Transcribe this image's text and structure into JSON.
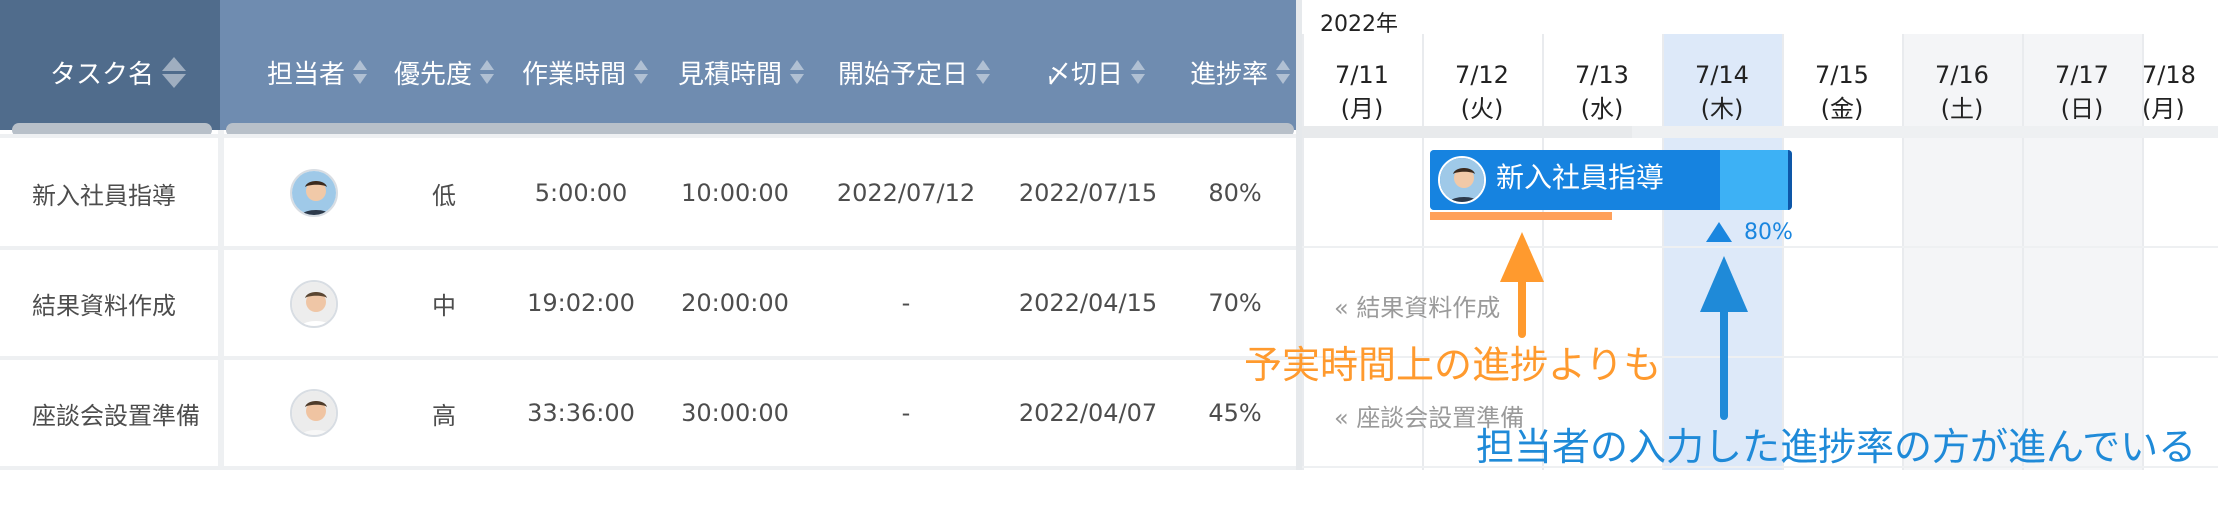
{
  "columns": {
    "name": "タスク名",
    "assignee": "担当者",
    "priority": "優先度",
    "work_time": "作業時間",
    "estimate": "見積時間",
    "start_date": "開始予定日",
    "due_date": "〆切日",
    "progress": "進捗率"
  },
  "rows": [
    {
      "name": "新入社員指導",
      "priority": "低",
      "work_time": "5:00:00",
      "estimate": "10:00:00",
      "start_date": "2022/07/12",
      "due_date": "2022/07/15",
      "progress": "80%"
    },
    {
      "name": "結果資料作成",
      "priority": "中",
      "work_time": "19:02:00",
      "estimate": "20:00:00",
      "start_date": "-",
      "due_date": "2022/04/15",
      "progress": "70%"
    },
    {
      "name": "座談会設置準備",
      "priority": "高",
      "work_time": "33:36:00",
      "estimate": "30:00:00",
      "start_date": "-",
      "due_date": "2022/04/07",
      "progress": "45%"
    }
  ],
  "gantt": {
    "year": "2022年",
    "days": [
      {
        "date": "7/11",
        "dow": "(月)"
      },
      {
        "date": "7/12",
        "dow": "(火)"
      },
      {
        "date": "7/13",
        "dow": "(水)"
      },
      {
        "date": "7/14",
        "dow": "(木)"
      },
      {
        "date": "7/15",
        "dow": "(金)"
      },
      {
        "date": "7/16",
        "dow": "(土)"
      },
      {
        "date": "7/17",
        "dow": "(日)"
      },
      {
        "date": "7/18",
        "dow": "(月)"
      }
    ],
    "bar_label": "新入社員指導",
    "bar_progress": "80%",
    "ghost_1": "« 結果資料作成",
    "ghost_2": "« 座談会設置準備"
  },
  "annotations": {
    "orange": "予実時間上の進捗よりも",
    "blue": "担当者の入力した進捗率の方が進んでいる"
  },
  "colors": {
    "header_name": "#506c8c",
    "header_rest": "#6f8cb0",
    "bar": "#3db1f5",
    "bar_done": "#1683e0",
    "plan_line": "#ffa05a",
    "today": "#dde9f9",
    "annotation_orange": "#ff9a2e",
    "annotation_blue": "#1f8ad8"
  }
}
